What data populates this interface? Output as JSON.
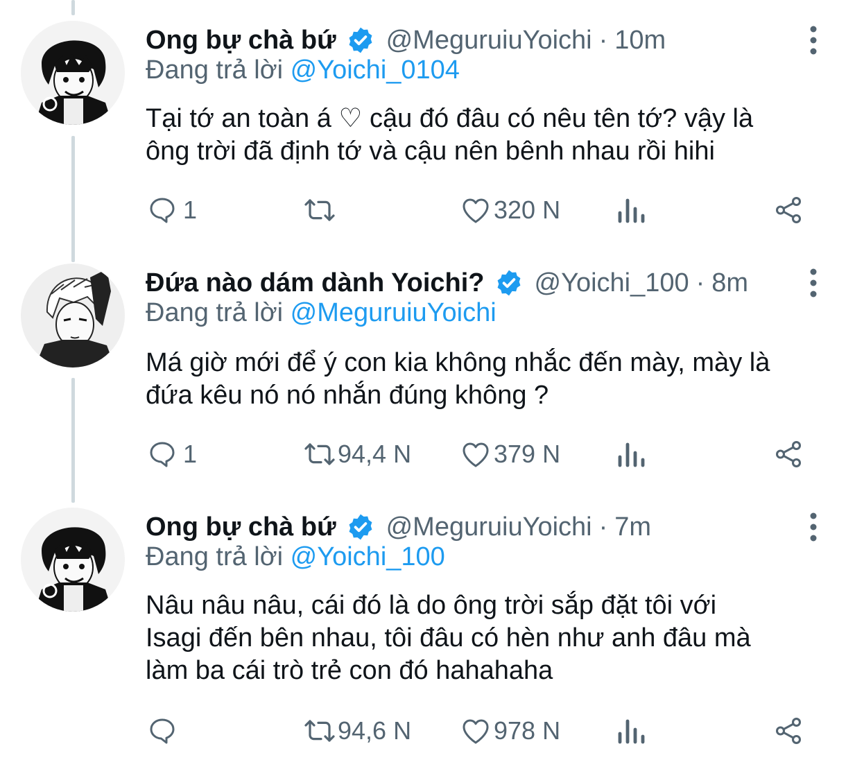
{
  "tweets": [
    {
      "display_name": "Ong bự chà bứ",
      "handle": "@MeguruiuYoichi",
      "separator": "·",
      "time": "10m",
      "reply_prefix": "Đang trả lời",
      "reply_to": "@Yoichi_0104",
      "text_lines": [
        "Tại tớ an toàn á ♡ cậu đó đâu có nêu tên tớ? vậy là",
        "ông trời đã định tớ và cậu nên bênh nhau rồi hihi"
      ],
      "replies": "1",
      "retweets": "",
      "likes": "320 N"
    },
    {
      "display_name": "Đứa nào dám dành Yoichi?",
      "handle": "@Yoichi_100",
      "separator": "·",
      "time": "8m",
      "reply_prefix": "Đang trả lời",
      "reply_to": "@MeguruiuYoichi",
      "text_lines": [
        "Má giờ mới để ý con kia không nhắc đến mày, mày là",
        "đứa kêu nó nó nhắn đúng không ?"
      ],
      "replies": "1",
      "retweets": "94,4 N",
      "likes": "379 N"
    },
    {
      "display_name": "Ong bự chà bứ",
      "handle": "@MeguruiuYoichi",
      "separator": "·",
      "time": "7m",
      "reply_prefix": "Đang trả lời",
      "reply_to": "@Yoichi_100",
      "text_lines": [
        "Nâu nâu nâu, cái đó là do ông trời sắp đặt tôi với",
        "Isagi đến bên nhau, tôi đâu có hèn như anh đâu mà",
        "làm ba cái trò trẻ con đó hahahaha"
      ],
      "replies": "",
      "retweets": "94,6 N",
      "likes": "978 N"
    }
  ],
  "icons": {
    "verified": "verified-badge-icon",
    "more": "more-vertical-icon",
    "reply": "reply-bubble-icon",
    "retweet": "retweet-icon",
    "like": "heart-icon",
    "views": "analytics-icon",
    "share": "share-icon"
  },
  "colors": {
    "text": "#0f1419",
    "muted": "#536471",
    "accent": "#1d9bf0",
    "thread_line": "#cfd9de"
  }
}
